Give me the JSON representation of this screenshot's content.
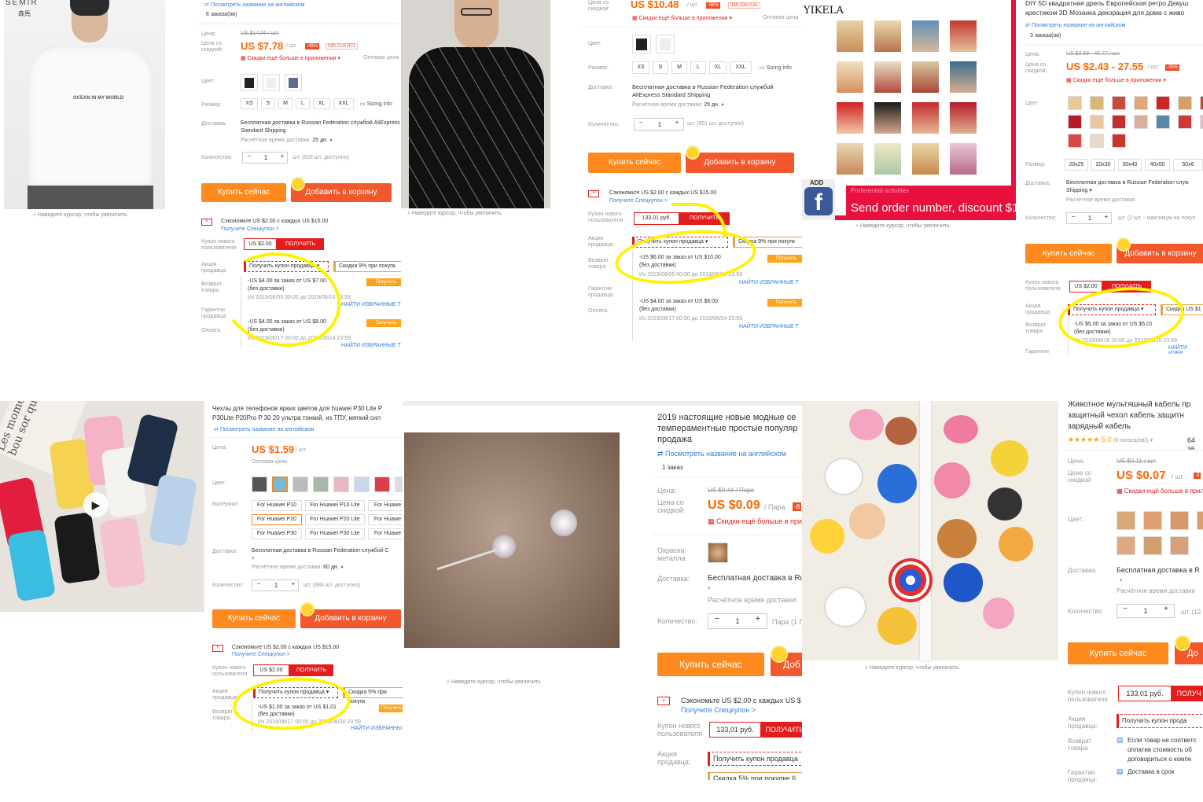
{
  "common": {
    "zoom_hint": "Наведите курсор, чтобы увеличить",
    "see_english": "Посмотреть название на английском",
    "price_label": "Цена:",
    "discount_price_label": "Цена со скидкой:",
    "more_in_app": "Скидки ещё больше в приложении",
    "wholesale": "Оптовая цена",
    "color_label": "Цвет:",
    "size_label": "Размер:",
    "sizing_info": "Sizing info",
    "delivery_label": "Доставка:",
    "delivery_value": "Бесплатная доставка в Russian Federation службой AliExpress Standard Shipping",
    "delivery_time": "Расчётное время доставки:",
    "qty_label": "Количество:",
    "qty_value": "1",
    "buy_now": "Купить сейчас",
    "add_to_cart": "Добавить в корзину",
    "save_text": "Сэкономьте US $2.00 с каждых US $15.00",
    "get_special": "Получите Спецкупон >",
    "new_user_coupon": "Купон нового пользователя",
    "get_btn": "ПОЛУЧИТЬ",
    "seller_promo": "Акция продавца:",
    "get_seller_coupon": "Получить купон продавца",
    "return": "Возврат товара",
    "guarantee": "Гарантии продавца:",
    "payment": "Оплата:",
    "no_delivery": "(без доставки)",
    "get_small": "Получить",
    "find_favorites": "НАЙТИ ИЗБРАННЫЕ Т"
  },
  "tile1": {
    "brand": "SEMIR",
    "brand_cn": "森馬",
    "shirt_text": "OCEAN IN MY WORLD",
    "orders": "6 заказа(ов)",
    "old_price": "US $14.06 / шт.",
    "price": "US $7.78",
    "unit": "/ шт.",
    "discount": "-48%",
    "timer": "08h:21m:47s",
    "sizes": [
      "XS",
      "S",
      "M",
      "L",
      "XL",
      "XXL"
    ],
    "delivery_days": "25 дн.",
    "stock": "шт. (528 шт. доступно)",
    "coupon_value": "US $2.00",
    "skidka": "Скидка 9% при покупк",
    "offer1": "-US $4.00 за заказ от US $7.00",
    "offer1_date": "Из 2019/06/05 00:00 до 2019/06/16 23:59",
    "offer2": "-US $4.00 за заказ от US $8.00",
    "offer2_date": "Из 2019/06/17 00:00 до 2019/06/24 23:59"
  },
  "tile2": {
    "price": "US $10.48",
    "unit": "/ шт.",
    "discount": "-48%",
    "timer": "08h:20m:53s",
    "sizes": [
      "XS",
      "S",
      "M",
      "L",
      "XL",
      "XXL"
    ],
    "delivery_days": "25 дн.",
    "stock": "шт. (651 шт. доступно)",
    "coupon_value": "133,01 руб.",
    "skidka": "Скидка 9% при покупк",
    "offer1": "-US $6.00 за заказ от US $10.00",
    "offer1_date": "Из 2019/06/05 00:00 до 2019/06/16 23:59",
    "offer2": "-US $4.00 за заказ от US $8.00",
    "offer2_date": "Из 2019/06/17 00:00 до 2019/06/24 23:59"
  },
  "tile3": {
    "brand": "YIKELA",
    "fb_add": "ADD",
    "preferential": "Preferential activities",
    "banner": "Send order number, discount $1",
    "title": "DIY 5D квадратная дрель Европейская ретро Девуш крестиком 3D Мозаика декорация для дома с живо",
    "orders": "3 заказа(ов)",
    "old_price": "US $3.99 - 45.77 / шт.",
    "price": "US $2.43 - 27.55",
    "unit": "/ шт.",
    "discount": "-39%",
    "sizes": [
      "20x25",
      "20x30",
      "30x40",
      "40x50",
      "50x6"
    ],
    "stock": "шт. (2 шт. - максимум на покуп",
    "coupon_value": "US $2.00",
    "skidka": "Скидка US $1",
    "offer1": "-US $5.00 за заказ от US $5.01",
    "offer1_date": "Из 2019/06/16 10:00 до 2019/06/16 23:59",
    "find": "НАЙТИ ИЗБР"
  },
  "tile4": {
    "title": "Чехлы для телефонов ярких цветов для huawei P30 Lite P P30Lite P20Pro P 30 20 ультра тонкий, из ТПУ, мягкий сил",
    "price": "US $1.59",
    "unit": "/ шт.",
    "material_label": "Материал:",
    "materials": [
      "For Huawei P10",
      "For Huawei P10 Lite",
      "For Huawe",
      "For Huawei P20",
      "For Huawei P20 Lite",
      "For Huawe",
      "For Huawei P30",
      "For Huawei P30 Lite",
      "For Huawe"
    ],
    "delivery_days": "60 дн.",
    "stock": "шт. (888 шт. доступно)",
    "coupon_value": "US $2.00",
    "skidka": "Скидка 5% при покупк",
    "offer1": "-US $1.00 за заказ от US $1.01",
    "offer1_date": "Из 2019/06/17 00:00 до 2019/06/30 23:59",
    "find": "НАЙТИ ИЗБРАННЫ"
  },
  "tile5": {
    "title": "2019 настоящие новые модные се темпераментные простые популяр продажа",
    "orders": "1 заказ",
    "old_price": "US $0.44 / Пара",
    "price": "US $0.09",
    "unit": "/ Пара",
    "discount": "-8",
    "metal_label": "Окраска металла:",
    "delivery_value": "Бесплатная доставка в Ru",
    "delivery_time": "Расчётное время доставки:",
    "qty_unit": "Пара (1 П",
    "add_short": "Доб",
    "save_text": "Сэкономьте US $2.00 с каждых US $",
    "coupon_value": "133,01 руб.",
    "skidka": "Скидка 5% при покупке 6"
  },
  "tile6": {
    "title": "Животное мультяшный кабель пр защитный чехол кабель защитн зарядный кабель",
    "rating": "5.0",
    "votes": "(6 голоса(ов))",
    "extra": "64 за",
    "old_price": "US $0.11 / шт.",
    "price": "US $0.07",
    "unit": "/ шт.",
    "discount": "-3",
    "delivery_value": "Бесплатная доставка в R",
    "delivery_time": "Расчётное время доставки",
    "stock": "шт. (12",
    "coupon_value": "133,01 руб.",
    "get_short": "ПОЛУЧ",
    "get_seller_coupon": "Получить купон прода",
    "return_text": "Если товар не соответс оплатив стоимость об договориться о компе",
    "delivery_on_time": "Доставка в срок",
    "add_short": "До"
  },
  "colors": {
    "orange": "#fe8a1f",
    "red": "#f2582b",
    "highlight": "#fff200",
    "price": "#ff6600"
  }
}
